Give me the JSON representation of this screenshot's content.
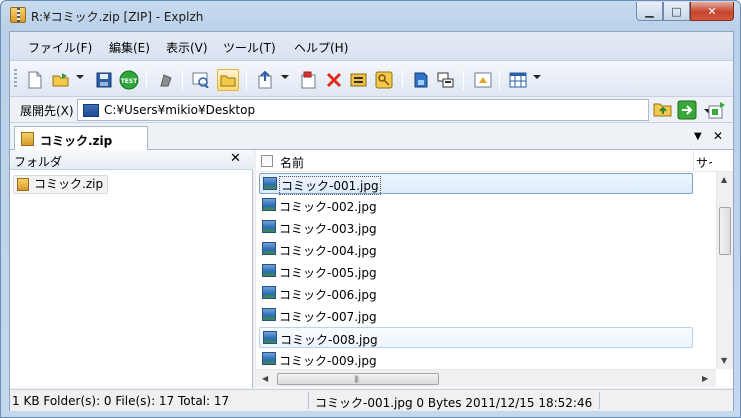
{
  "window": {
    "title": "R:¥コミック.zip [ZIP] - Explzh",
    "minimize_label": "▁",
    "maximize_label": "□",
    "close_label": "✕"
  },
  "menu": {
    "items": [
      {
        "label": "ファイル(F)"
      },
      {
        "label": "編集(E)"
      },
      {
        "label": "表示(V)"
      },
      {
        "label": "ツール(T)"
      },
      {
        "label": "ヘルプ(H)"
      }
    ]
  },
  "toolbar": {
    "icons": [
      "new-archive-icon",
      "open-icon",
      "save-icon",
      "test-icon",
      "extract-icon",
      "view-icon",
      "folder-view-icon",
      "add-icon",
      "delete-icon",
      "properties-icon",
      "key-icon",
      "sfx-icon",
      "split-icon",
      "info-icon",
      "layout-icon"
    ],
    "test_label": "TEST"
  },
  "address": {
    "label": "展開先(X)",
    "value": "C:¥Users¥mikio¥Desktop"
  },
  "tab": {
    "label": "コミック.zip",
    "menu_glyph": "▼",
    "close_glyph": "✕"
  },
  "folder_pane": {
    "title": "フォルダ",
    "close_glyph": "✕",
    "root_item": "コミック.zip"
  },
  "file_list": {
    "columns": {
      "name": "名前",
      "size": "サイズ"
    },
    "rows": [
      {
        "name": "コミック-001.jpg"
      },
      {
        "name": "コミック-002.jpg"
      },
      {
        "name": "コミック-003.jpg"
      },
      {
        "name": "コミック-004.jpg"
      },
      {
        "name": "コミック-005.jpg"
      },
      {
        "name": "コミック-006.jpg"
      },
      {
        "name": "コミック-007.jpg"
      },
      {
        "name": "コミック-008.jpg"
      },
      {
        "name": "コミック-009.jpg"
      }
    ],
    "selected_row": 0,
    "hover_row": 7
  },
  "status": {
    "summary": "1 KB  Folder(s): 0  File(s): 17  Total: 17",
    "selection": "コミック-001.jpg  0 Bytes  2011/12/15 18:52:46"
  }
}
